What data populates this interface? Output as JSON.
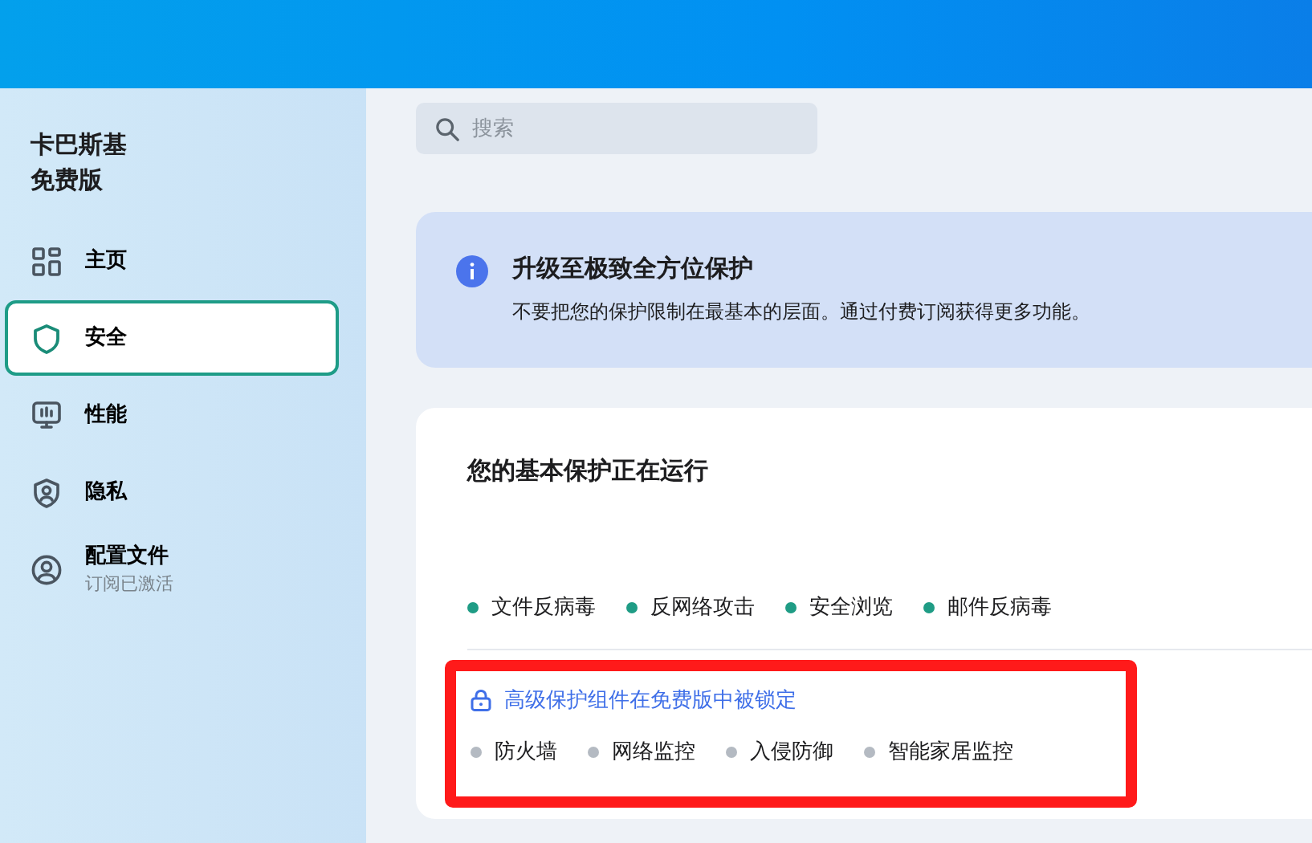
{
  "sidebar": {
    "brand": [
      "卡巴斯基",
      "免费版"
    ],
    "items": [
      {
        "kind": "home",
        "label": "主页",
        "selected": false
      },
      {
        "kind": "shield",
        "label": "安全",
        "selected": true
      },
      {
        "kind": "monitor",
        "label": "性能",
        "selected": false
      },
      {
        "kind": "privacy",
        "label": "隐私",
        "selected": false
      },
      {
        "kind": "profile",
        "label": "配置文件",
        "subtitle": "订阅已激活",
        "selected": false
      }
    ]
  },
  "search": {
    "placeholder": "搜索"
  },
  "banner": {
    "title": "升级至极致全方位保护",
    "text": "不要把您的保护限制在最基本的层面。通过付费订阅获得更多功能。"
  },
  "protection": {
    "title": "您的基本保护正在运行",
    "components": [
      {
        "label": "文件反病毒",
        "active": true
      },
      {
        "label": "反网络攻击",
        "active": true
      },
      {
        "label": "安全浏览",
        "active": true
      },
      {
        "label": "邮件反病毒",
        "active": true
      }
    ],
    "locked_section": {
      "highlighted": true,
      "title": "高级保护组件在免费版中被锁定",
      "components": [
        {
          "label": "防火墙",
          "active": false
        },
        {
          "label": "网络监控",
          "active": false
        },
        {
          "label": "入侵防御",
          "active": false
        },
        {
          "label": "智能家居监控",
          "active": false
        }
      ]
    }
  }
}
